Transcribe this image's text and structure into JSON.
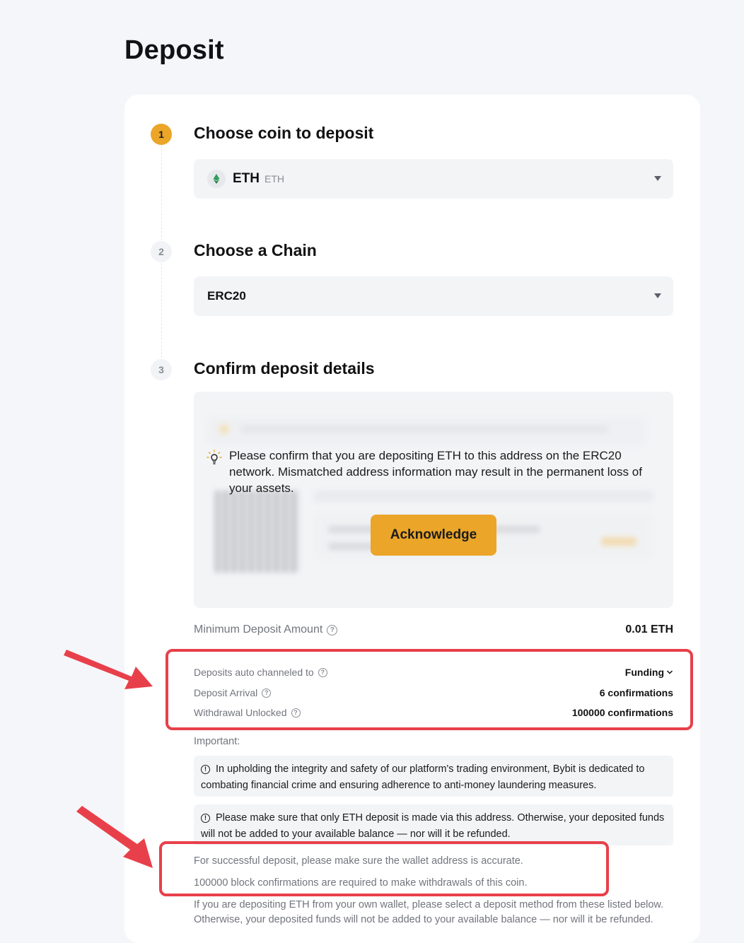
{
  "page": {
    "title": "Deposit"
  },
  "steps": [
    {
      "number": "1",
      "title": "Choose coin to deposit"
    },
    {
      "number": "2",
      "title": "Choose a Chain"
    },
    {
      "number": "3",
      "title": "Confirm deposit details"
    }
  ],
  "coin_select": {
    "symbol": "ETH",
    "name": "ETH",
    "icon": "ethereum-icon"
  },
  "chain_select": {
    "value": "ERC20"
  },
  "confirm": {
    "notice": "Please confirm that you are depositing ETH to this address on the ERC20 network. Mismatched address information may result in the permanent loss of your assets.",
    "acknowledge_label": "Acknowledge",
    "icon": "lightbulb-icon"
  },
  "details": {
    "min_deposit_label": "Minimum Deposit Amount",
    "min_deposit_value": "0.01 ETH",
    "channel_label": "Deposits auto channeled to",
    "channel_value": "Funding",
    "arrival_label": "Deposit Arrival",
    "arrival_value": "6 confirmations",
    "unlock_label": "Withdrawal Unlocked",
    "unlock_value": "100000 confirmations"
  },
  "important": {
    "label": "Important:",
    "notice_1": "In upholding the integrity and safety of our platform's trading environment, Bybit is dedicated to combating financial crime and ensuring adherence to anti-money laundering measures.",
    "notice_2": "Please make sure that only ETH deposit is made via this address. Otherwise, your deposited funds will not be added to your available balance — nor will it be refunded.",
    "line_1": "For successful deposit, please make sure the wallet address is accurate.",
    "line_2": "100000 block confirmations are required to make withdrawals of this coin.",
    "line_3": "If you are depositing ETH from your own wallet, please select a deposit method from these listed below.",
    "line_4": "Otherwise, your deposited funds will not be added to your available balance — nor will it be refunded."
  },
  "colors": {
    "accent": "#eba528",
    "highlight": "#e8404a",
    "background": "#f5f6f9"
  }
}
